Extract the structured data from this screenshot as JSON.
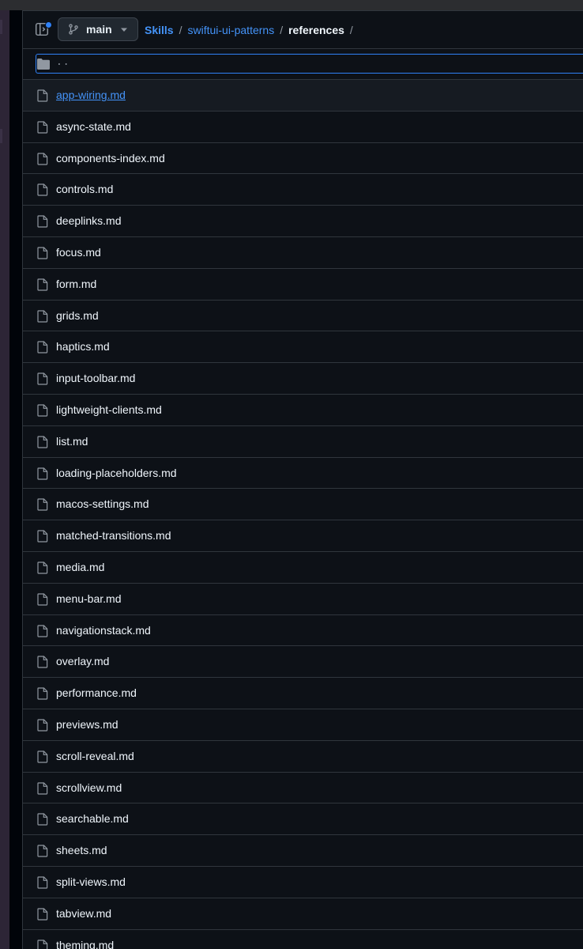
{
  "branch": {
    "name": "main"
  },
  "breadcrumb": {
    "root": "Skills",
    "repo": "swiftui-ui-patterns",
    "current": "references",
    "separator": "/"
  },
  "parent_dir": "..",
  "files": [
    "app-wiring.md",
    "async-state.md",
    "components-index.md",
    "controls.md",
    "deeplinks.md",
    "focus.md",
    "form.md",
    "grids.md",
    "haptics.md",
    "input-toolbar.md",
    "lightweight-clients.md",
    "list.md",
    "loading-placeholders.md",
    "macos-settings.md",
    "matched-transitions.md",
    "media.md",
    "menu-bar.md",
    "navigationstack.md",
    "overlay.md",
    "performance.md",
    "previews.md",
    "scroll-reveal.md",
    "scrollview.md",
    "searchable.md",
    "sheets.md",
    "split-views.md",
    "tabview.md",
    "theming.md"
  ],
  "hovered_file": "app-wiring.md",
  "icons": {
    "panel_toggle": "sidebar-expand-icon",
    "branch": "git-branch-icon",
    "caret": "triangle-down-icon",
    "folder": "folder-icon",
    "file": "file-icon"
  },
  "colors": {
    "background": "#0d1117",
    "border": "#30363d",
    "link": "#4493f8",
    "text": "#f0f6fc",
    "muted": "#9198a1",
    "accent": "#2f81f7"
  }
}
